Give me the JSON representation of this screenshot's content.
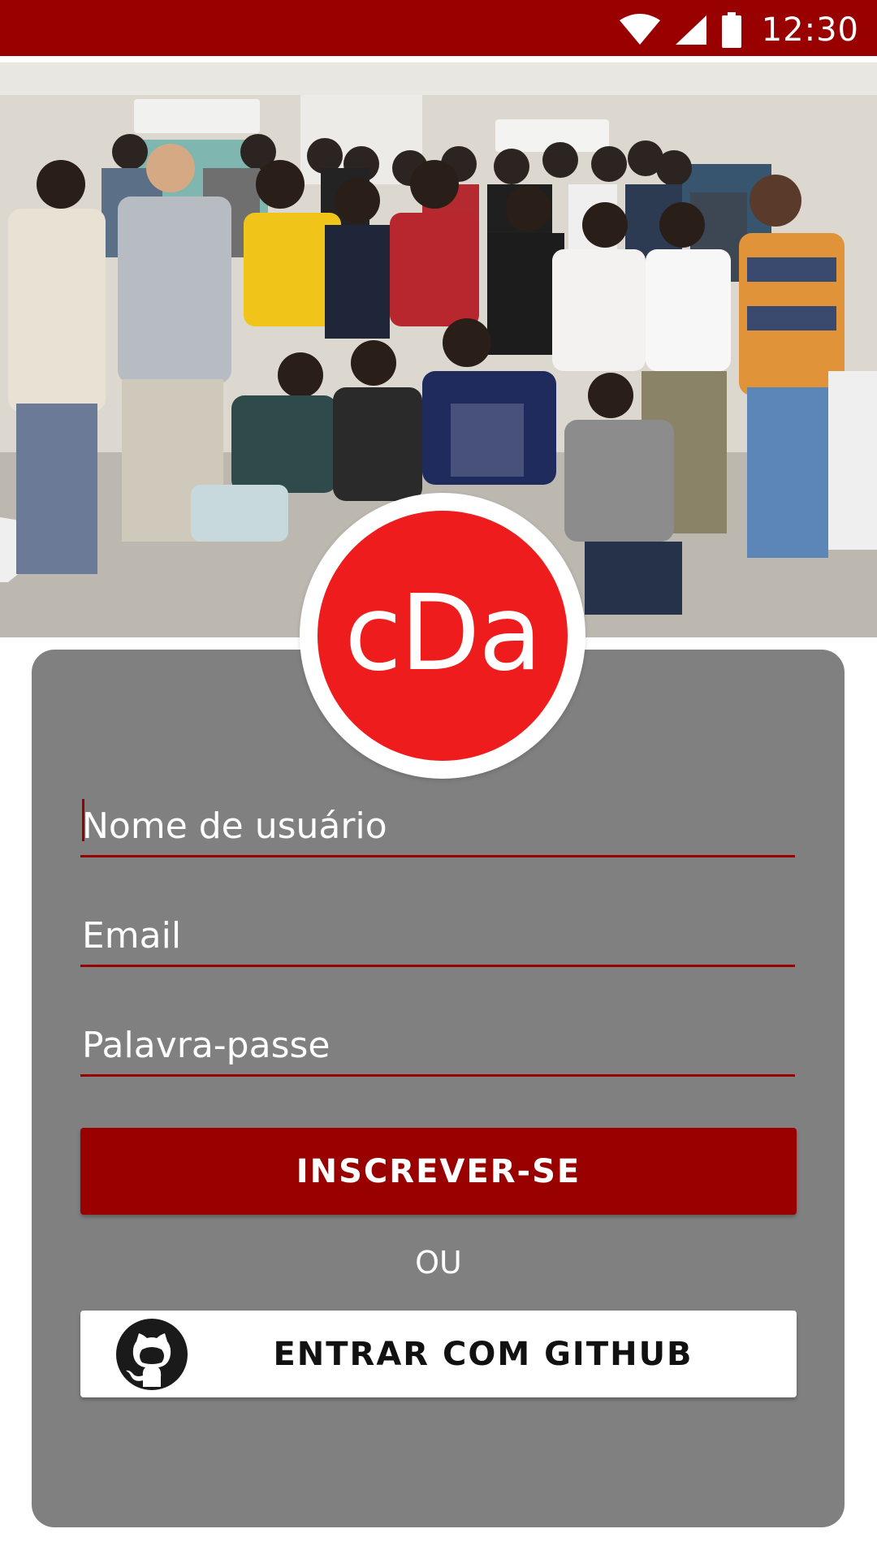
{
  "status_bar": {
    "time": "12:30",
    "wifi_icon": "wifi-icon",
    "signal_icon": "signal-icon",
    "battery_icon": "battery-icon"
  },
  "hero": {
    "image": "group-photo"
  },
  "logo": {
    "text": "cDa"
  },
  "form": {
    "username_placeholder": "Nome de usuário",
    "email_placeholder": "Email",
    "password_placeholder": "Palavra-passe",
    "signup_label": "INSCREVER-SE",
    "or_label": "OU",
    "github_label": "ENTRAR COM GITHUB",
    "github_icon": "github-icon"
  },
  "colors": {
    "primary": "#990000",
    "logo_red": "#ee1c1c",
    "card": "#808080"
  }
}
